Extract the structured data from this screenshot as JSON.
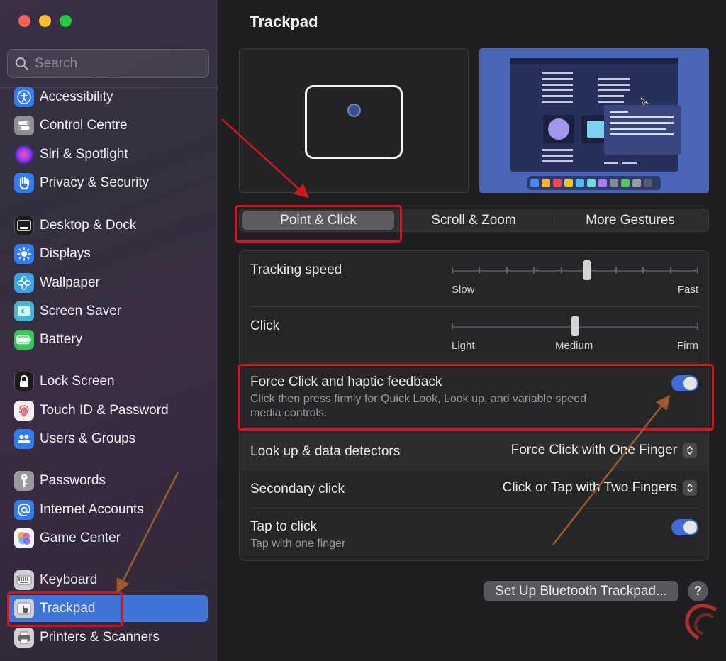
{
  "window": {
    "title": "Trackpad"
  },
  "search": {
    "placeholder": "Search"
  },
  "sidebar": {
    "items": [
      {
        "label": "Accessibility",
        "icon": "accessibility-icon",
        "color": "#2f7cf6"
      },
      {
        "label": "Control Centre",
        "icon": "control-centre-icon",
        "color": "#8e8e93"
      },
      {
        "label": "Siri & Spotlight",
        "icon": "siri-icon",
        "color": "#c043d8"
      },
      {
        "label": "Privacy & Security",
        "icon": "hand-icon",
        "color": "#2f7cf6"
      },
      {
        "label": "Desktop & Dock",
        "icon": "dock-icon",
        "color": "#1c1c1e"
      },
      {
        "label": "Displays",
        "icon": "sun-icon",
        "color": "#2f7cf6"
      },
      {
        "label": "Wallpaper",
        "icon": "flower-icon",
        "color": "#3aa3e6"
      },
      {
        "label": "Screen Saver",
        "icon": "screen-saver-icon",
        "color": "#42b8d6"
      },
      {
        "label": "Battery",
        "icon": "battery-icon",
        "color": "#34c759"
      },
      {
        "label": "Lock Screen",
        "icon": "lock-icon",
        "color": "#1c1c1e"
      },
      {
        "label": "Touch ID & Password",
        "icon": "fingerprint-icon",
        "color": "#f2f2f2"
      },
      {
        "label": "Users & Groups",
        "icon": "users-icon",
        "color": "#2f7cf6"
      },
      {
        "label": "Passwords",
        "icon": "key-icon",
        "color": "#9a9a9e"
      },
      {
        "label": "Internet Accounts",
        "icon": "at-icon",
        "color": "#2f7cf6"
      },
      {
        "label": "Game Center",
        "icon": "game-center-icon",
        "color": "#e05ca8"
      },
      {
        "label": "Keyboard",
        "icon": "keyboard-icon",
        "color": "#c8c8cc"
      },
      {
        "label": "Trackpad",
        "icon": "trackpad-icon",
        "color": "#c8c8cc",
        "selected": true
      },
      {
        "label": "Printers & Scanners",
        "icon": "printer-icon",
        "color": "#c8c8cc"
      }
    ]
  },
  "tabs": [
    {
      "label": "Point & Click",
      "selected": true
    },
    {
      "label": "Scroll & Zoom",
      "selected": false
    },
    {
      "label": "More Gestures",
      "selected": false
    }
  ],
  "settings": {
    "tracking_speed": {
      "label": "Tracking speed",
      "min_label": "Slow",
      "max_label": "Fast",
      "value": 0.55
    },
    "click": {
      "label": "Click",
      "min_label": "Light",
      "mid_label": "Medium",
      "max_label": "Firm",
      "value": 0.5
    },
    "force_click": {
      "label": "Force Click and haptic feedback",
      "description": "Click then press firmly for Quick Look, Look up, and variable speed media controls.",
      "enabled": true
    },
    "look_up": {
      "label": "Look up & data detectors",
      "value": "Force Click with One Finger"
    },
    "secondary_click": {
      "label": "Secondary click",
      "value": "Click or Tap with Two Fingers"
    },
    "tap_to_click": {
      "label": "Tap to click",
      "description": "Tap with one finger",
      "enabled": true
    }
  },
  "buttons": {
    "bluetooth": "Set Up Bluetooth Trackpad...",
    "help": "?"
  },
  "colors": {
    "accent": "#3f74d6",
    "annotation": "#d4161b",
    "toggle_on": "#3f6bd6"
  }
}
